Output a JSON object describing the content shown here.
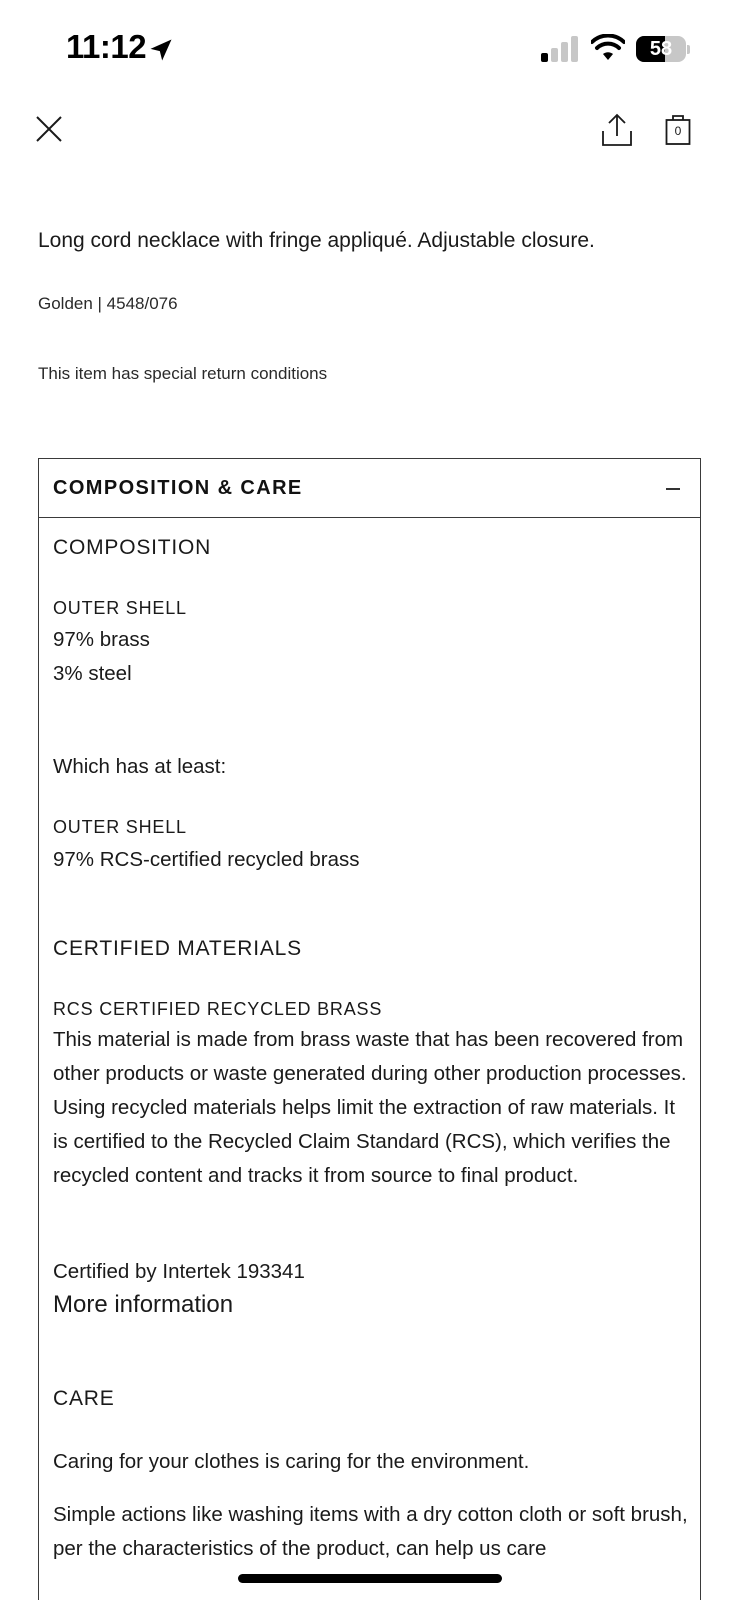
{
  "status_bar": {
    "time": "11:12",
    "battery_level": "58",
    "battery_fraction": 0.58
  },
  "nav": {
    "bag_count": "0"
  },
  "product": {
    "description": "Long cord necklace with fringe appliqué. Adjustable closure.",
    "color_ref": "Golden | 4548/076",
    "return_note": "This item has special return conditions"
  },
  "accordion": {
    "title": "COMPOSITION & CARE",
    "expanded": true,
    "composition": {
      "heading": "COMPOSITION",
      "outer_shell_label": "OUTER SHELL",
      "materials": [
        "97% brass",
        "3% steel"
      ],
      "at_least_label": "Which has at least:",
      "outer_shell_label_2": "OUTER SHELL",
      "recycled_line": "97% RCS-certified recycled brass"
    },
    "certified": {
      "heading": "CERTIFIED MATERIALS",
      "material_label": "RCS CERTIFIED RECYCLED BRASS",
      "description": "This material is made from brass waste that has been recovered from other products or waste generated during other production processes. Using recycled materials helps limit the extraction of raw materials. It is certified to the Recycled Claim Standard (RCS), which verifies the recycled content and tracks it from source to final product.",
      "certified_by": "Certified by Intertek 193341",
      "more_info_link": "More information"
    },
    "care": {
      "heading": "CARE",
      "intro": "Caring for your clothes is caring for the environment.",
      "text": "Simple actions like washing items with a dry cotton cloth or soft brush, per the characteristics of the product, can help us care"
    }
  }
}
